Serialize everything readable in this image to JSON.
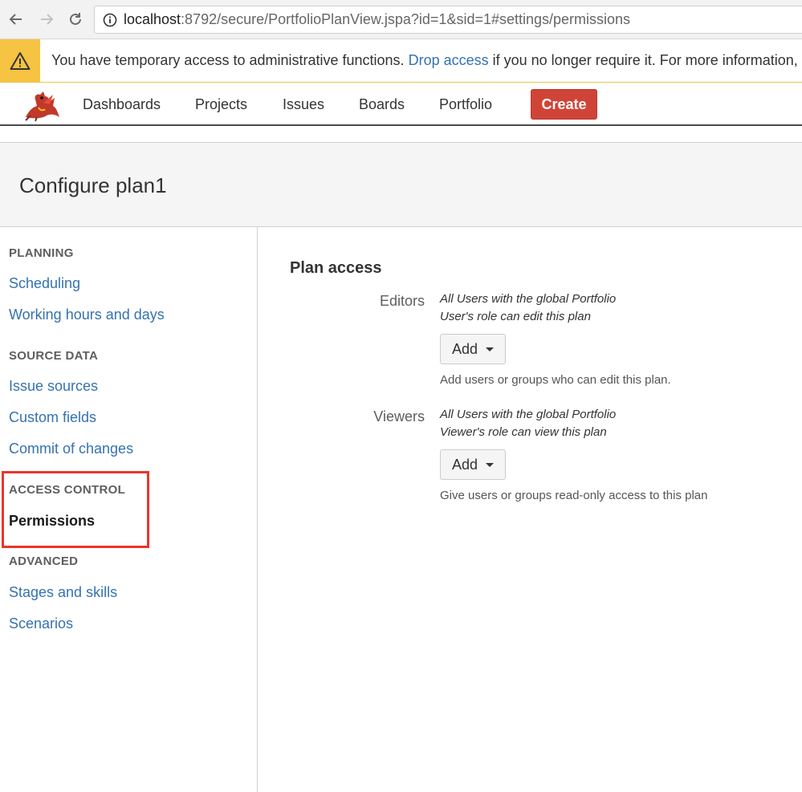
{
  "browser": {
    "url_host": "localhost",
    "url_rest": ":8792/secure/PortfolioPlanView.jspa?id=1&sid=1#settings/permissions"
  },
  "warning": {
    "text_before": "You have temporary access to administrative functions.",
    "link": "Drop access",
    "text_after": "if you no longer require it. For more information,"
  },
  "nav": {
    "dashboards": "Dashboards",
    "projects": "Projects",
    "issues": "Issues",
    "boards": "Boards",
    "portfolio": "Portfolio",
    "create": "Create"
  },
  "page": {
    "title": "Configure plan1"
  },
  "sidebar": {
    "planning": "PLANNING",
    "scheduling": "Scheduling",
    "working_hours": "Working hours and days",
    "source_data": "SOURCE DATA",
    "issue_sources": "Issue sources",
    "custom_fields": "Custom fields",
    "commit_changes": "Commit of changes",
    "access_control": "ACCESS CONTROL",
    "permissions": "Permissions",
    "advanced": "ADVANCED",
    "stages_skills": "Stages and skills",
    "scenarios": "Scenarios"
  },
  "main": {
    "section_title": "Plan access",
    "editors": {
      "label": "Editors",
      "desc_line1": "All Users with the global Portfolio",
      "desc_line2": "User's role can edit this plan",
      "add": "Add",
      "help": "Add users or groups who can edit this plan."
    },
    "viewers": {
      "label": "Viewers",
      "desc_line1": "All Users with the global Portfolio",
      "desc_line2": "Viewer's role can view this plan",
      "add": "Add",
      "help": "Give users or groups read-only access to this plan"
    }
  },
  "colors": {
    "link": "#3572b0",
    "create": "#d04437",
    "warning": "#f6c342",
    "highlight": "#e8372b"
  }
}
